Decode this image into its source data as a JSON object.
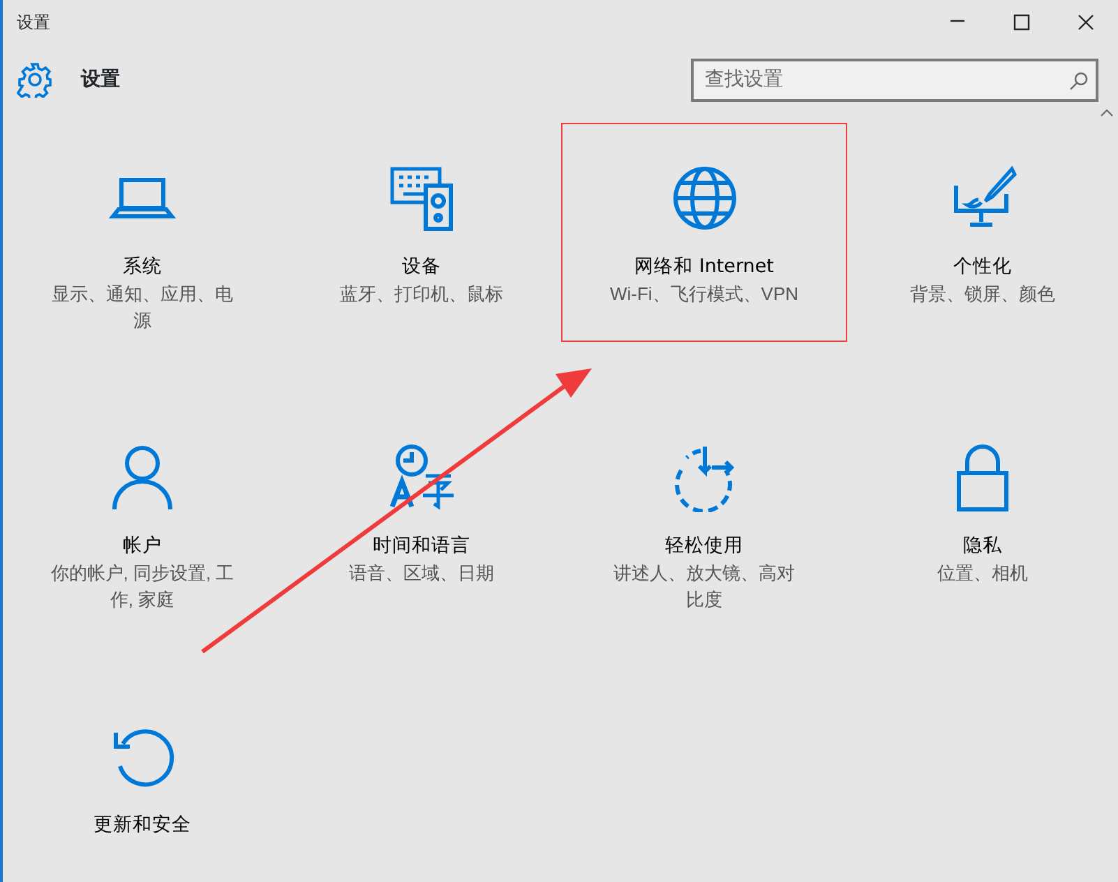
{
  "window": {
    "title": "设置"
  },
  "header": {
    "title": "设置",
    "search": {
      "placeholder": "查找设置"
    }
  },
  "tiles": [
    {
      "kind": "laptop",
      "title": "系统",
      "subtitle": "显示、通知、应用、电源",
      "highlighted": false
    },
    {
      "kind": "devices",
      "title": "设备",
      "subtitle": "蓝牙、打印机、鼠标",
      "highlighted": false
    },
    {
      "kind": "globe",
      "title": "网络和 Internet",
      "subtitle": "Wi-Fi、飞行模式、VPN",
      "highlighted": true
    },
    {
      "kind": "paint",
      "title": "个性化",
      "subtitle": "背景、锁屏、颜色",
      "highlighted": false
    },
    {
      "kind": "person",
      "title": "帐户",
      "subtitle": "你的帐户, 同步设置, 工作, 家庭",
      "highlighted": false
    },
    {
      "kind": "language",
      "title": "时间和语言",
      "subtitle": "语音、区域、日期",
      "highlighted": false
    },
    {
      "kind": "ease",
      "title": "轻松使用",
      "subtitle": "讲述人、放大镜、高对比度",
      "highlighted": false
    },
    {
      "kind": "lock",
      "title": "隐私",
      "subtitle": "位置、相机",
      "highlighted": false
    },
    {
      "kind": "update",
      "title": "更新和安全",
      "highlighted": false
    }
  ],
  "annotations": [
    {
      "kind": "arrow"
    }
  ]
}
